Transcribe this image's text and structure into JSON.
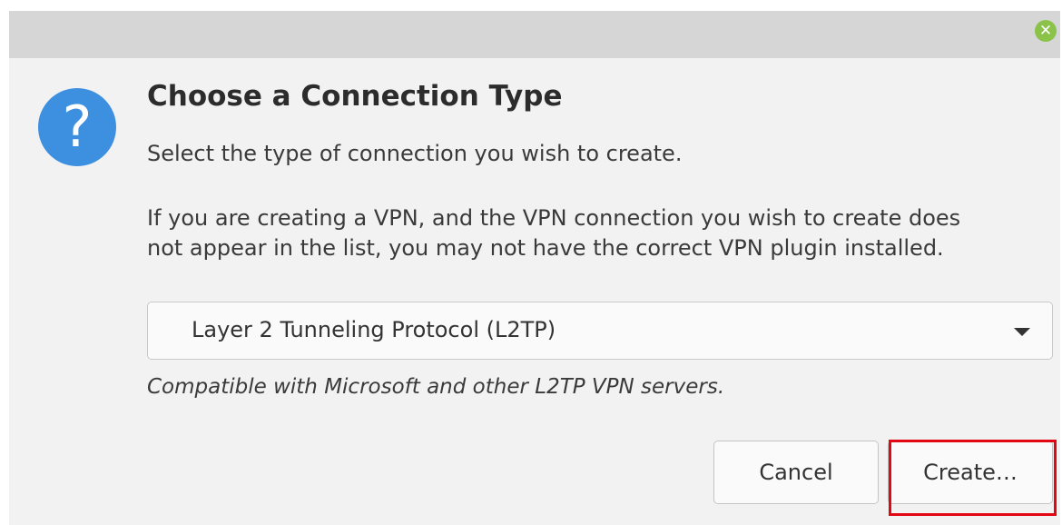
{
  "window": {
    "close_glyph": "✕"
  },
  "dialog": {
    "icon_glyph": "?",
    "title": "Choose a Connection Type",
    "subtitle": "Select the type of connection you wish to create.",
    "info_line1": "If you are creating a VPN, and the VPN connection you wish to create does",
    "info_line2": "not appear in the list, you may not have the correct VPN plugin installed.",
    "connection_type": {
      "selected": "Layer 2 Tunneling Protocol (L2TP)",
      "description": "Compatible with Microsoft and other L2TP VPN servers."
    },
    "buttons": {
      "cancel": "Cancel",
      "create": "Create…"
    }
  },
  "colors": {
    "icon_blue": "#3d8fe0",
    "close_green": "#8bc34a",
    "highlight_red": "#e30613"
  }
}
